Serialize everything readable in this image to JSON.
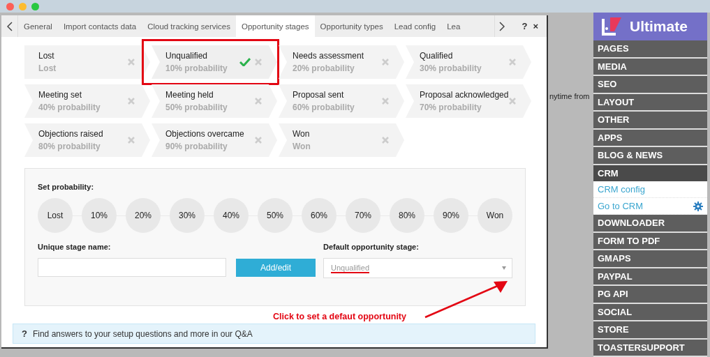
{
  "tabs": [
    {
      "label": "General",
      "selected": false
    },
    {
      "label": "Import contacts data",
      "selected": false
    },
    {
      "label": "Cloud tracking services",
      "selected": false
    },
    {
      "label": "Opportunity stages",
      "selected": true
    },
    {
      "label": "Opportunity types",
      "selected": false
    },
    {
      "label": "Lead config",
      "selected": false
    },
    {
      "label": "Lea",
      "selected": false
    }
  ],
  "tab_actions": {
    "help": "?",
    "close": "×"
  },
  "stages": [
    {
      "name": "Lost",
      "subtitle": "Lost",
      "selected": false
    },
    {
      "name": "Unqualified",
      "subtitle": "10% probability",
      "selected": true
    },
    {
      "name": "Needs assessment",
      "subtitle": "20% probability",
      "selected": false
    },
    {
      "name": "Qualified",
      "subtitle": "30% probability",
      "selected": false
    },
    {
      "name": "Meeting set",
      "subtitle": "40% probability",
      "selected": false
    },
    {
      "name": "Meeting held",
      "subtitle": "50% probability",
      "selected": false
    },
    {
      "name": "Proposal sent",
      "subtitle": "60% probability",
      "selected": false
    },
    {
      "name": "Proposal acknowledged",
      "subtitle": "70% probability",
      "selected": false
    },
    {
      "name": "Objections raised",
      "subtitle": "80% probability",
      "selected": false
    },
    {
      "name": "Objections overcame",
      "subtitle": "90% probability",
      "selected": false
    },
    {
      "name": "Won",
      "subtitle": "Won",
      "selected": false
    }
  ],
  "probability": {
    "label": "Set probability:",
    "options": [
      "Lost",
      "10%",
      "20%",
      "30%",
      "40%",
      "50%",
      "60%",
      "70%",
      "80%",
      "90%",
      "Won"
    ]
  },
  "stage_name": {
    "label": "Unique stage name:"
  },
  "add_button": "Add/edit",
  "default_stage": {
    "label": "Default opportunity stage:",
    "value": "Unqualified"
  },
  "annotation": "Click to set a defaut opportunity",
  "info_bar": {
    "icon": "?",
    "text": "Find answers to your setup questions and more in our Q&A"
  },
  "background_text": "nytime from",
  "sidebar": {
    "logo": "Ultimate",
    "items": [
      {
        "label": "PAGES",
        "expanded": false
      },
      {
        "label": "MEDIA",
        "expanded": false
      },
      {
        "label": "SEO",
        "expanded": false
      },
      {
        "label": "LAYOUT",
        "expanded": false
      },
      {
        "label": "OTHER",
        "expanded": false
      },
      {
        "label": "APPS",
        "expanded": false
      },
      {
        "label": "BLOG & NEWS",
        "expanded": false
      },
      {
        "label": "CRM",
        "expanded": true,
        "children": [
          {
            "label": "CRM config",
            "kind": "plain"
          },
          {
            "label": "Go to CRM",
            "kind": "gear"
          }
        ]
      },
      {
        "label": "DOWNLOADER",
        "expanded": false
      },
      {
        "label": "FORM TO PDF",
        "expanded": false
      },
      {
        "label": "GMAPS",
        "expanded": false
      },
      {
        "label": "PAYPAL",
        "expanded": false
      },
      {
        "label": "PG API",
        "expanded": false
      },
      {
        "label": "SOCIAL",
        "expanded": false
      },
      {
        "label": "STORE",
        "expanded": false
      },
      {
        "label": "TOASTERSUPPORT",
        "expanded": false
      }
    ]
  }
}
